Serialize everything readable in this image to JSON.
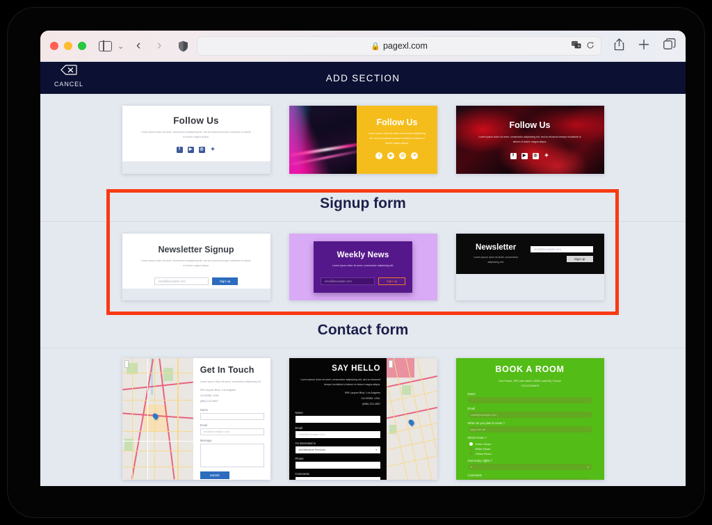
{
  "browser": {
    "url": "pagexl.com",
    "lock_icon": "lock-icon",
    "back_icon": "‹",
    "forward_icon": "›",
    "reload_icon": "reload-icon",
    "translate_icon": "translate-icon",
    "share_icon": "share-icon",
    "new_tab_icon": "+",
    "tabs_icon": "tabs-icon",
    "shield_icon": "privacy-shield-icon",
    "sidebar_icon": "sidebar-icon",
    "chevron_icon": "⌄"
  },
  "app_header": {
    "cancel_label": "CANCEL",
    "cancel_icon": "backspace-delete-icon",
    "title": "ADD SECTION"
  },
  "sections": [
    {
      "id": "follow-us",
      "heading": "Follow Us",
      "cards": [
        {
          "style": "white",
          "title": "Follow Us",
          "body": "Lorem ipsum dolor sit amet, consectetur adipisicing elit, sed do eiusmod tempor incididunt ut labore et dolore magna aliqua.",
          "socials": [
            "f",
            "▶",
            "◎",
            "🐦"
          ]
        },
        {
          "style": "yellow-photo",
          "title": "Follow Us",
          "body": "Lorem ipsum dolor sit amet, consectetur adipisicing elit, sed do eiusmod tempor incididunt ut labore et dolore magna aliqua.",
          "socials": [
            "f",
            "▶",
            "◎",
            "🐦"
          ]
        },
        {
          "style": "red",
          "title": "Follow Us",
          "body": "Lorem ipsum dolor sit amet, consectetur adipisicing elit, sed do eiusmod tempor incididunt ut labore et dolore magna aliqua.",
          "socials": [
            "f",
            "▶",
            "◎",
            "🐦"
          ]
        }
      ]
    },
    {
      "id": "signup-form",
      "heading": "Signup form",
      "highlighted": true,
      "cards": [
        {
          "style": "white",
          "title": "Newsletter Signup",
          "body": "Lorem ipsum dolor sit amet, consectetur adipisicing elit, sed do eiusmod tempor incididunt ut labore et dolore magna aliqua.",
          "email_placeholder": "email@example.com",
          "button": "Sign up"
        },
        {
          "style": "purple",
          "title": "Weekly News",
          "body": "Lorem ipsum dolor sit amet, consectetur adipisicing elit.",
          "email_placeholder": "email@example.com",
          "button": "Sign up"
        },
        {
          "style": "black",
          "title": "Newsletter",
          "body": "Lorem ipsum dolor sit amet, consectetur adipisicing elit.",
          "email_placeholder": "email@example.com",
          "button": "Sign up"
        }
      ]
    },
    {
      "id": "contact-form",
      "heading": "Contact form",
      "cards": [
        {
          "style": "map-left",
          "title": "Get In Touch",
          "body": "Lorem ipsum dolor sit amet, consectetur adipisicing elit.",
          "address": "999 Laupen Blvd, Los Angeles\nCA 90350, USA.\n(888) 123-4567",
          "fields": [
            {
              "label": "Name",
              "placeholder": ""
            },
            {
              "label": "Email",
              "placeholder": "email@example.com"
            },
            {
              "label": "Message",
              "placeholder": "",
              "type": "textarea"
            }
          ],
          "button": "Submit"
        },
        {
          "style": "black-map-right",
          "title": "SAY HELLO",
          "body": "Lorem ipsum dolor sit amet, consectetur adipisicing elit, sed do eiusmod tempor incididunt ut labore et dolore magna aliqua.",
          "address": "999 Laupen Blvd, Los Angeles\nCA 90350, USA.\n(888) 123-4567",
          "fields": [
            {
              "label": "Name",
              "placeholder": ""
            },
            {
              "label": "Email",
              "placeholder": "email@example.com"
            },
            {
              "label": "I'm interested in",
              "value": "Architectural Services",
              "type": "select"
            },
            {
              "label": "Phone",
              "placeholder": ""
            },
            {
              "label": "Comments",
              "placeholder": "",
              "type": "textarea"
            }
          ]
        },
        {
          "style": "green",
          "title": "BOOK A ROOM",
          "address": "Doe House, 999 Lake street, 00000 LakeCity, France\n+33 012346678",
          "fields": [
            {
              "label": "Name",
              "placeholder": ""
            },
            {
              "label": "Email",
              "placeholder": "email@example.com"
            },
            {
              "label": "When do you plan to come ?",
              "placeholder": "yyyy-mm-dd"
            },
            {
              "label": "Which Room ?",
              "type": "radio",
              "options": [
                "Green Room",
                "White Room",
                "Yellow Room"
              ],
              "selected": 0
            },
            {
              "label": "How many nights ?",
              "value": "1",
              "type": "select"
            },
            {
              "label": "Comments",
              "placeholder": "",
              "type": "textarea"
            }
          ]
        }
      ]
    }
  ],
  "colors": {
    "highlight": "#f93a13",
    "header_bg": "#0c1033",
    "page_bg": "#e4e8ef",
    "heading": "#1b1f48",
    "blue_button": "#2c6bbd",
    "yellow": "#f5bd1b",
    "purple": "#55188a",
    "green": "#54bc17"
  }
}
